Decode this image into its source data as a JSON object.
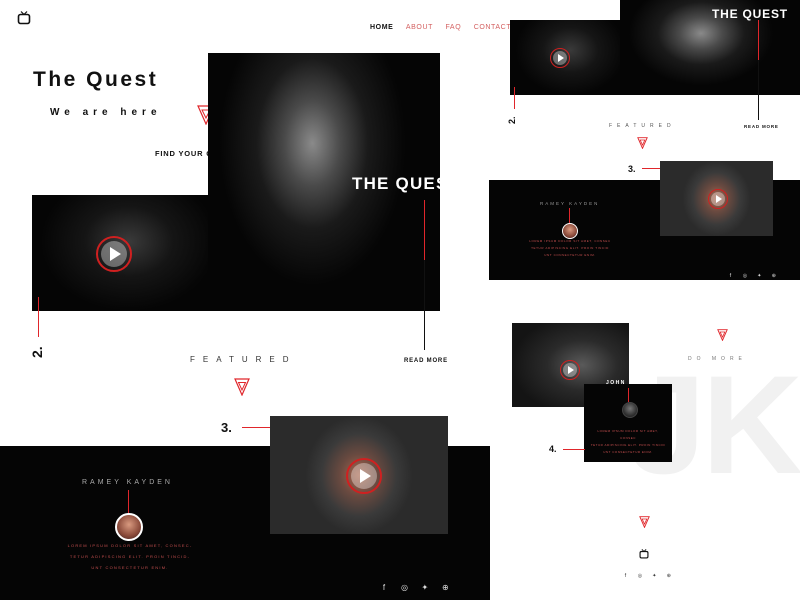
{
  "brand": {
    "icon": "tv-icon"
  },
  "nav": {
    "items": [
      "HOME",
      "ABOUT",
      "FAQ",
      "CONTACT"
    ],
    "active": "HOME"
  },
  "hero": {
    "title": "The Quest",
    "subtitle": "We are here",
    "cta": "FIND YOUR QUEST",
    "overlay_title": "THE QUEST",
    "read_more": "READ MORE",
    "step_label": "2."
  },
  "featured": {
    "label": "FEATURED",
    "step_label": "3.",
    "person_name": "RAMEY KAYDEN",
    "lorem_lines": [
      "LOREM IPSUM DOLOR SIT AMET, CONSEC-",
      "TETUR ADIPISCING ELIT. PROIN TINCID-",
      "UNT CONSECTETUR ENIM."
    ]
  },
  "right_top": {
    "overlay_title": "THE QUEST",
    "read_more": "READ MORE",
    "step_label": "2.",
    "featured_label": "FEATURED"
  },
  "right_mid": {
    "step_label": "3.",
    "person_name": "RAMEY KAYDEN",
    "lorem_lines": [
      "LOREM IPSUM DOLOR SIT AMET, CONSEC",
      "TETUR ADIPISCING ELIT. PROIN TINCID",
      "UNT CONSECTETUR ENIM."
    ]
  },
  "right_bottom": {
    "do_more": "DO MORE",
    "person_name": "JOHN KOTA",
    "step_label": "4.",
    "watermark": "JK",
    "lorem_lines": [
      "LOREM IPSUM DOLOR SIT AMET, CONSEC",
      "TETUR ADIPISCING ELIT. PROIN TINCID",
      "UNT CONSECTETUR ENIM."
    ]
  },
  "social": [
    "facebook-icon",
    "instagram-icon",
    "twitter-icon",
    "dribbble-icon"
  ],
  "colors": {
    "accent": "#e0262b",
    "dark": "#050505",
    "bg": "#ffffff"
  }
}
